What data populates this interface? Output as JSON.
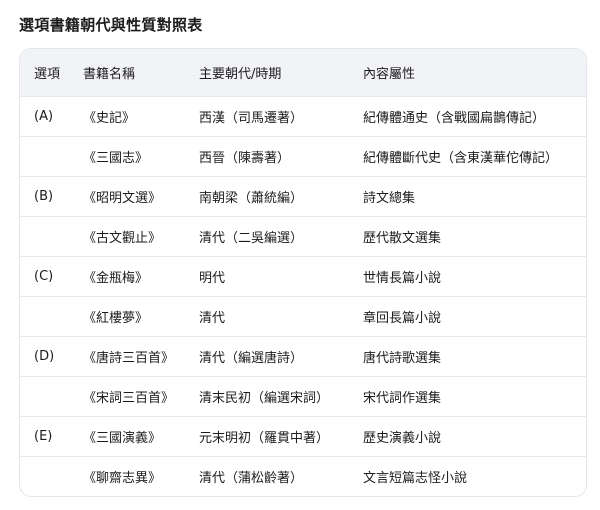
{
  "title": "選項書籍朝代與性質對照表",
  "headers": [
    "選項",
    "書籍名稱",
    "主要朝代/時期",
    "內容屬性"
  ],
  "rows": [
    {
      "option": "(A)",
      "book": "《史記》",
      "dynasty": "西漢（司馬遷著）",
      "nature": "紀傳體通史（含戰國扁鵲傳記）"
    },
    {
      "option": "",
      "book": "《三國志》",
      "dynasty": "西晉（陳壽著）",
      "nature": "紀傳體斷代史（含東漢華佗傳記）"
    },
    {
      "option": "(B)",
      "book": "《昭明文選》",
      "dynasty": "南朝梁（蕭統編）",
      "nature": "詩文總集"
    },
    {
      "option": "",
      "book": "《古文觀止》",
      "dynasty": "清代（二吳編選）",
      "nature": "歷代散文選集"
    },
    {
      "option": "(C)",
      "book": "《金瓶梅》",
      "dynasty": "明代",
      "nature": "世情長篇小說"
    },
    {
      "option": "",
      "book": "《紅樓夢》",
      "dynasty": "清代",
      "nature": "章回長篇小說"
    },
    {
      "option": "(D)",
      "book": "《唐詩三百首》",
      "dynasty": "清代（編選唐詩）",
      "nature": "唐代詩歌選集"
    },
    {
      "option": "",
      "book": "《宋詞三百首》",
      "dynasty": "清末民初（編選宋詞）",
      "nature": "宋代詞作選集"
    },
    {
      "option": "(E)",
      "book": "《三國演義》",
      "dynasty": "元末明初（羅貫中著）",
      "nature": "歷史演義小說"
    },
    {
      "option": "",
      "book": "《聊齋志異》",
      "dynasty": "清代（蒲松齡著）",
      "nature": "文言短篇志怪小說"
    }
  ]
}
